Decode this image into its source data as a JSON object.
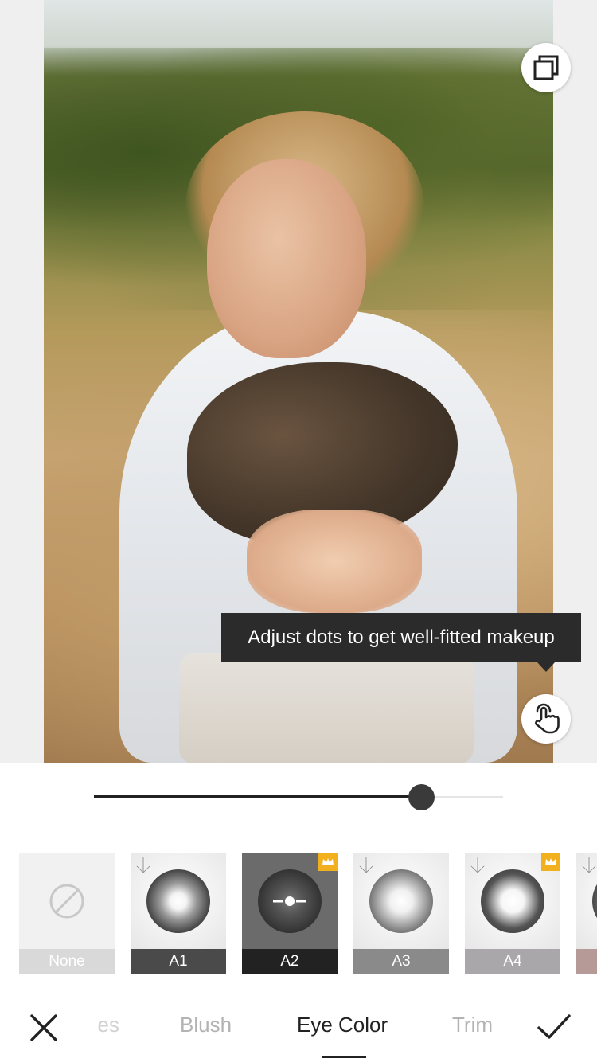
{
  "tooltip": {
    "text": "Adjust dots to get well-fitted makeup"
  },
  "intensity_slider": {
    "value": 0.8
  },
  "presets": [
    {
      "label": "None",
      "downloadable": false,
      "premium": false,
      "selected": false
    },
    {
      "label": "A1",
      "downloadable": true,
      "premium": false,
      "selected": false
    },
    {
      "label": "A2",
      "downloadable": false,
      "premium": true,
      "selected": true
    },
    {
      "label": "A3",
      "downloadable": true,
      "premium": false,
      "selected": false
    },
    {
      "label": "A4",
      "downloadable": true,
      "premium": true,
      "selected": false
    }
  ],
  "tabs": {
    "partial_label": "es",
    "blush_label": "Blush",
    "eye_color_label": "Eye Color",
    "trim_label": "Trim",
    "active": "Eye Color"
  },
  "colors": {
    "accent_premium": "#f2b01e",
    "tooltip_bg": "#2b2b2b",
    "selected_label_bg": "#222222"
  },
  "icons": {
    "compare": "compare-icon",
    "touch": "touch-hand-icon",
    "close": "close-icon",
    "confirm": "checkmark-icon",
    "none": "no-symbol-icon",
    "download": "download-arrow-icon",
    "premium": "crown-icon"
  }
}
